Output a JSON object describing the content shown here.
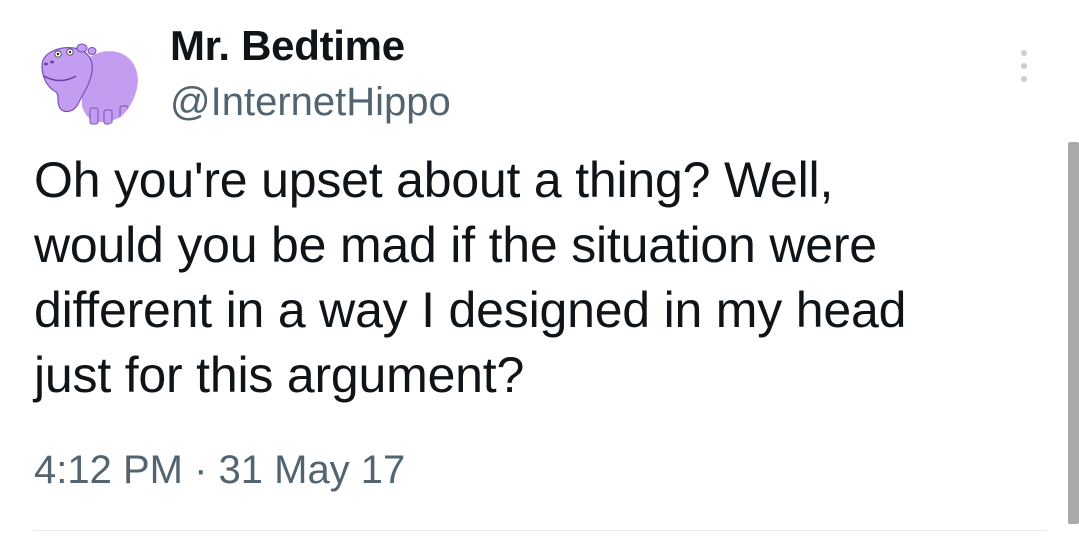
{
  "tweet": {
    "author": {
      "display_name": "Mr. Bedtime",
      "handle": "@InternetHippo",
      "avatar_icon": "purple-hippo-avatar"
    },
    "text": "Oh you're upset about a thing? Well,\nwould you be mad if the situation were\ndifferent in a way I designed in my head\njust for this argument?",
    "timestamp": "4:12 PM · 31 May 17",
    "more_icon": "more-vertical-icon"
  },
  "colors": {
    "text_primary": "#0f1419",
    "text_secondary": "#536471",
    "avatar_purple": "#c39df0",
    "scrollbar": "#aaaaaa"
  }
}
